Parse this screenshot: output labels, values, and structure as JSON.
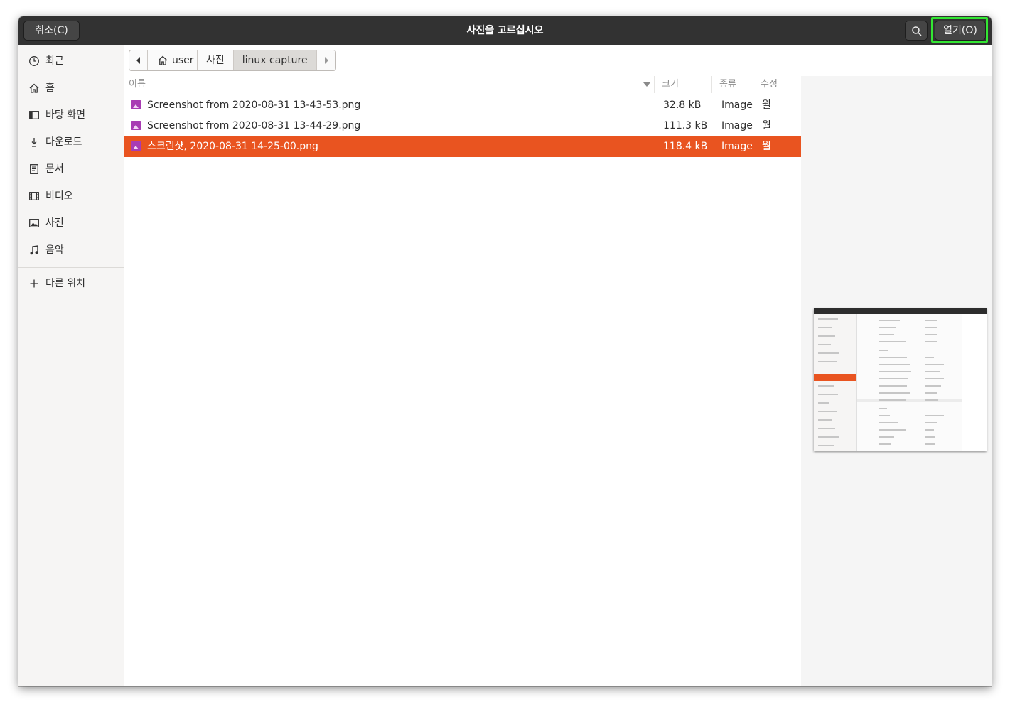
{
  "header": {
    "cancel_label": "취소(C)",
    "title": "사진을 고르십시오",
    "open_label": "열기(O)"
  },
  "sidebar": {
    "items": [
      {
        "label": "최근",
        "icon": "clock-icon"
      },
      {
        "label": "홈",
        "icon": "home-icon"
      },
      {
        "label": "바탕 화면",
        "icon": "desktop-icon"
      },
      {
        "label": "다운로드",
        "icon": "download-icon"
      },
      {
        "label": "문서",
        "icon": "document-icon"
      },
      {
        "label": "비디오",
        "icon": "video-icon"
      },
      {
        "label": "사진",
        "icon": "picture-icon"
      },
      {
        "label": "음악",
        "icon": "music-icon"
      }
    ],
    "other_locations": "다른 위치"
  },
  "pathbar": {
    "segments": [
      "user",
      "사진",
      "linux capture"
    ]
  },
  "columns": {
    "name": "이름",
    "size": "크기",
    "type": "종류",
    "modified": "수정"
  },
  "files": [
    {
      "name": "Screenshot from 2020-08-31 13-43-53.png",
      "size": "32.8 kB",
      "type": "Image",
      "modified": "월"
    },
    {
      "name": "Screenshot from 2020-08-31 13-44-29.png",
      "size": "111.3 kB",
      "type": "Image",
      "modified": "월"
    },
    {
      "name": "스크린샷, 2020-08-31 14-25-00.png",
      "size": "118.4 kB",
      "type": "Image",
      "modified": "월",
      "selected": true
    }
  ],
  "colors": {
    "headerbar": "#323232",
    "selection": "#e95420",
    "file_icon": "#a83cb3",
    "highlight": "#33e633"
  }
}
